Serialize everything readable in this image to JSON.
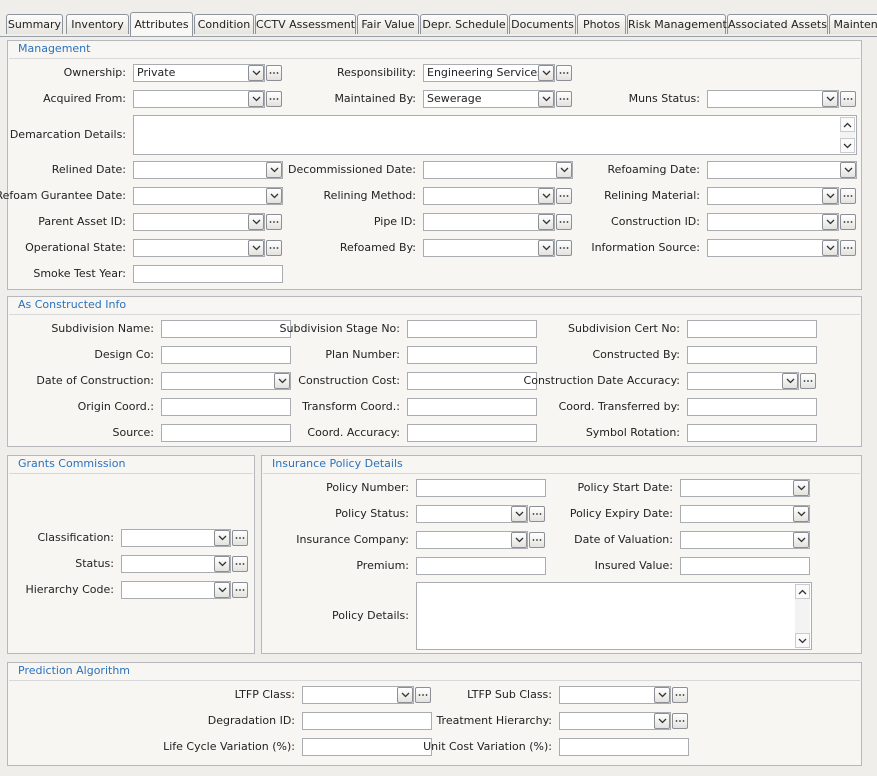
{
  "tabs": [
    "Summary",
    "Inventory",
    "Attributes",
    "Condition",
    "CCTV Assessment",
    "Fair Value",
    "Depr. Schedule",
    "Documents",
    "Photos",
    "Risk Management",
    "Associated Assets",
    "Maintena"
  ],
  "active_tab": "Attributes",
  "management": {
    "title": "Management",
    "ownership": {
      "label": "Ownership:",
      "value": "Private"
    },
    "responsibility": {
      "label": "Responsibility:",
      "value": "Engineering Services"
    },
    "acquired_from": {
      "label": "Acquired From:",
      "value": ""
    },
    "maintained_by": {
      "label": "Maintained By:",
      "value": "Sewerage"
    },
    "muns_status": {
      "label": "Muns Status:",
      "value": ""
    },
    "demarcation_details": {
      "label": "Demarcation Details:",
      "value": ""
    },
    "relined_date": {
      "label": "Relined Date:",
      "value": ""
    },
    "decommissioned_date": {
      "label": "Decommissioned Date:",
      "value": ""
    },
    "refoaming_date": {
      "label": "Refoaming Date:",
      "value": ""
    },
    "refoam_guarantee_date": {
      "label": "Refoam Gurantee Date:",
      "value": ""
    },
    "relining_method": {
      "label": "Relining Method:",
      "value": ""
    },
    "relining_material": {
      "label": "Relining Material:",
      "value": ""
    },
    "parent_asset_id": {
      "label": "Parent Asset ID:",
      "value": ""
    },
    "pipe_id": {
      "label": "Pipe ID:",
      "value": ""
    },
    "construction_id": {
      "label": "Construction ID:",
      "value": ""
    },
    "operational_state": {
      "label": "Operational State:",
      "value": ""
    },
    "refoamed_by": {
      "label": "Refoamed By:",
      "value": ""
    },
    "information_source": {
      "label": "Information Source:",
      "value": ""
    },
    "smoke_test_year": {
      "label": "Smoke Test Year:",
      "value": ""
    }
  },
  "as_constructed": {
    "title": "As Constructed Info",
    "subdivision_name": {
      "label": "Subdivision Name:",
      "value": ""
    },
    "subdivision_stage_no": {
      "label": "Subdivision Stage No:",
      "value": ""
    },
    "subdivision_cert_no": {
      "label": "Subdivision Cert No:",
      "value": ""
    },
    "design_co": {
      "label": "Design Co:",
      "value": ""
    },
    "plan_number": {
      "label": "Plan Number:",
      "value": ""
    },
    "constructed_by": {
      "label": "Constructed By:",
      "value": ""
    },
    "date_of_construction": {
      "label": "Date of Construction:",
      "value": ""
    },
    "construction_cost": {
      "label": "Construction Cost:",
      "value": ""
    },
    "construction_date_accuracy": {
      "label": "Construction Date Accuracy:",
      "value": ""
    },
    "origin_coord": {
      "label": "Origin Coord.:",
      "value": ""
    },
    "transform_coord": {
      "label": "Transform Coord.:",
      "value": ""
    },
    "coord_transferred_by": {
      "label": "Coord. Transferred by:",
      "value": ""
    },
    "source": {
      "label": "Source:",
      "value": ""
    },
    "coord_accuracy": {
      "label": "Coord. Accuracy:",
      "value": ""
    },
    "symbol_rotation": {
      "label": "Symbol Rotation:",
      "value": ""
    }
  },
  "grants": {
    "title": "Grants Commission",
    "classification": {
      "label": "Classification:",
      "value": ""
    },
    "status": {
      "label": "Status:",
      "value": ""
    },
    "hierarchy_code": {
      "label": "Hierarchy Code:",
      "value": ""
    }
  },
  "insurance": {
    "title": "Insurance Policy Details",
    "policy_number": {
      "label": "Policy Number:",
      "value": ""
    },
    "policy_start_date": {
      "label": "Policy Start Date:",
      "value": ""
    },
    "policy_status": {
      "label": "Policy Status:",
      "value": ""
    },
    "policy_expiry_date": {
      "label": "Policy Expiry Date:",
      "value": ""
    },
    "insurance_company": {
      "label": "Insurance Company:",
      "value": ""
    },
    "date_of_valuation": {
      "label": "Date of Valuation:",
      "value": ""
    },
    "premium": {
      "label": "Premium:",
      "value": ""
    },
    "insured_value": {
      "label": "Insured Value:",
      "value": ""
    },
    "policy_details": {
      "label": "Policy Details:",
      "value": ""
    }
  },
  "prediction": {
    "title": "Prediction Algorithm",
    "ltfp_class": {
      "label": "LTFP Class:",
      "value": ""
    },
    "ltfp_sub_class": {
      "label": "LTFP Sub Class:",
      "value": ""
    },
    "degradation_id": {
      "label": "Degradation ID:",
      "value": ""
    },
    "treatment_hierarchy": {
      "label": "Treatment Hierarchy:",
      "value": ""
    },
    "life_cycle_variation": {
      "label": "Life Cycle Variation (%):",
      "value": ""
    },
    "unit_cost_variation": {
      "label": "Unit Cost Variation (%):",
      "value": ""
    }
  },
  "icons": {
    "dropdown": "chevron-down-icon",
    "ellipsis": "ellipsis-icon",
    "scroll_up": "scroll-up-icon",
    "scroll_down": "scroll-down-icon"
  }
}
